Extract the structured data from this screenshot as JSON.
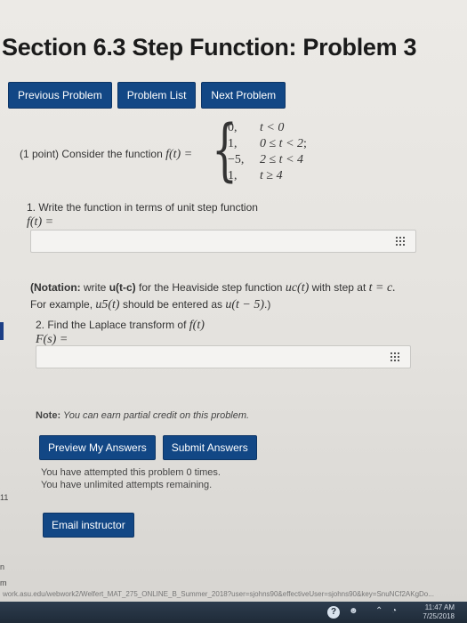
{
  "page": {
    "title": "Section 6.3 Step Function: Problem 3"
  },
  "nav": {
    "previous": "Previous Problem",
    "list": "Problem List",
    "next": "Next Problem"
  },
  "problem": {
    "points": "(1 point) Consider the function",
    "f_of_t": "f(t) =",
    "piecewise": [
      {
        "value": "0,",
        "condition": "t < 0"
      },
      {
        "value": "1,",
        "condition": "0 ≤ t < 2"
      },
      {
        "value": "−5,",
        "condition": "2 ≤ t < 4"
      },
      {
        "value": "1,",
        "condition": "t ≥ 4"
      }
    ],
    "semicolon": ";",
    "part1": {
      "prompt": "1. Write the function in terms of unit step function",
      "lhs": "f(t) ="
    },
    "notation": {
      "label": "(Notation:",
      "text1": "write",
      "code": "u(t-c)",
      "text2": "for the Heaviside step function",
      "uc": "uc(t)",
      "text3": "with step at",
      "tc": "t = c.",
      "line2a": "For example,",
      "u5": "u5(t)",
      "line2b": "should be entered as",
      "u_expr": "u(t − 5)",
      "close": ".)"
    },
    "part2": {
      "prompt": "2. Find the Laplace transform of",
      "ft": "f(t)",
      "lhs": "F(s) ="
    }
  },
  "note": {
    "label": "Note:",
    "text": "You can earn partial credit on this problem."
  },
  "actions": {
    "preview": "Preview My Answers",
    "submit": "Submit Answers"
  },
  "attempts": {
    "line1": "You have attempted this problem 0 times.",
    "line2": "You have unlimited attempts remaining."
  },
  "email": {
    "label": "Email instructor"
  },
  "sidebar_marks": {
    "m1": "11",
    "m2": "n",
    "m3": "m"
  },
  "status_bar": {
    "url": "work.asu.edu/webwork2/Welfert_MAT_275_ONLINE_B_Summer_2018?user=sjohns90&effectiveUser=sjohns90&key=SnuNCf2AKgDo..."
  },
  "taskbar": {
    "help": "?",
    "time": "11:47 AM",
    "date": "7/25/2018"
  },
  "colors": {
    "button": "#124785",
    "background": "#eceae6"
  }
}
